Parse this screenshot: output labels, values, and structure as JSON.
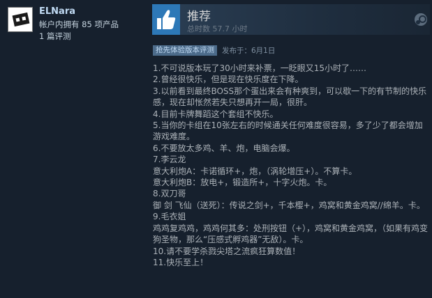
{
  "user": {
    "name": "ELNara",
    "owned": "帐户内拥有 85 项产品",
    "reviews": "1 篇评测"
  },
  "review": {
    "verdict": "推荐",
    "hours": "总时数 57.7 小时",
    "badge": "抢先体验版本评测",
    "posted": "发布于：6月1日",
    "lines": [
      "1.不可说版本玩了30小时来补票，一眨眼又15小时了……",
      "2.曾经很快乐，但是现在快乐度在下降。",
      "3.以前看到最终BOSS那个蛋出来会有种爽到，可以歇一下的有节制的快乐感，现在却怅然若失只想再开一局，很肝。",
      "4.目前卡牌舞蹈这个套组不快乐。",
      "5.当你的卡组在10张左右的时候通关任何难度很容易，多了少了都会增加游戏难度。",
      "6.不要放太多鸡、羊、炮，电脑会爆。",
      "7.李云龙",
      "意大利炮A：卡诺循环+，炮，（涡轮增压+）。不算卡。",
      "意大利炮B：放电+，锻造所+，十字火炮。卡。",
      "8.双刀哥",
      "御 剑 飞仙（送死）：传说之剑+，千本樱+，鸡窝和黄金鸡窝//绵羊。卡。",
      "9.毛衣姐",
      "鸡鸡复鸡鸡，鸡鸡何其多：处刑按钮（+），鸡窝和黄金鸡窝，（如果有鸡变狗圣物，那么“压感式孵鸡器”无敌）。卡。",
      "10.请不要学杀戮尖塔之流疯狂算数值！",
      "11.快乐至上！"
    ]
  },
  "colors": {
    "background": "#16202d",
    "thumb": "#2d78b7",
    "badge": "#4c6b8a",
    "text": "#acb2b8",
    "username": "#c1dbf4"
  },
  "icons": [
    "avatar",
    "thumbs-up-icon",
    "steam-icon"
  ]
}
